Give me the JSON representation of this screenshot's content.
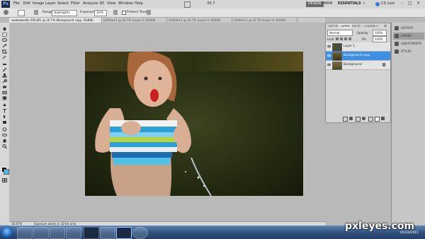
{
  "app": {
    "logo": "Ps"
  },
  "menubar": {
    "items": [
      "File",
      "Edit",
      "Image",
      "Layer",
      "Select",
      "Filter",
      "Analysis",
      "3D",
      "View",
      "Window",
      "Help"
    ],
    "zoom": "33.7",
    "workspaces": [
      "DESIGN",
      "MAIN",
      "ESSENTIALS"
    ],
    "live": "CS Live"
  },
  "options": {
    "range_label": "Range:",
    "range_value": "Highlights",
    "exposure_label": "Exposure:",
    "exposure_value": "10%",
    "protect_tones": "Protect Tones"
  },
  "tabs": [
    "iwakewoodly 000.JPG @ 16.7% (Background copy, RGB/8)",
    "Untitled-1 @ 16.7% (Layer 0, RGB/8)",
    "Untitled-1 @ 16.7% (Layer 0, RGB/8)",
    "Untitled-1 @ 16.7% (Layer 0, RGB/8)"
  ],
  "status": {
    "zoom": "16.67%",
    "info": "Exposure works in 32-bit only"
  },
  "layers_panel": {
    "tabs": [
      "HISTOR",
      "LAYERS",
      "PATHS",
      "CHANNELS"
    ],
    "active_tab": "LAYERS",
    "blend_mode": "Normal",
    "opacity_label": "Opacity:",
    "opacity_value": "100%",
    "lock_label": "Lock:",
    "fill_label": "Fill:",
    "fill_value": "100%",
    "layers": [
      {
        "name": "Layer 1",
        "selected": false
      },
      {
        "name": "Background copy",
        "selected": true
      },
      {
        "name": "Background",
        "selected": false
      }
    ]
  },
  "dock": {
    "items": [
      "HISTORY",
      "LAYERS",
      "ADJUSTMENTS",
      "STYLES"
    ]
  },
  "watermark": "pxleyes.com",
  "clock": "05/18/2011"
}
